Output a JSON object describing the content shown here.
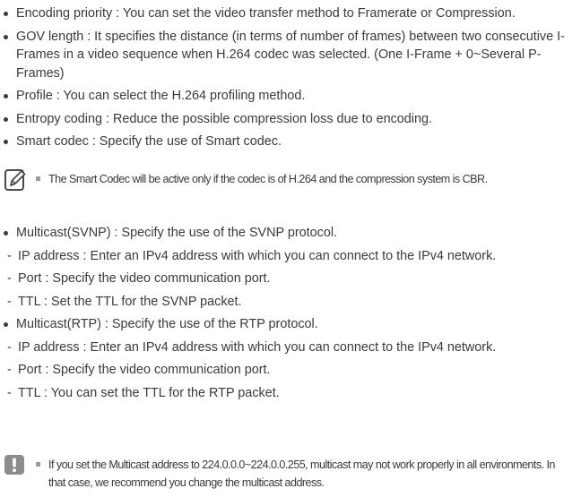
{
  "section1": {
    "items": [
      "Encoding priority : You can set the video transfer method to Framerate or Compression.",
      "GOV length : It specifies the distance (in terms of number of frames) between two consecutive I-Frames in a video sequence when H.264 codec was selected. (One I-Frame + 0~Several P-Frames)",
      "Profile : You can select the H.264 profiling method.",
      "Entropy coding : Reduce the possible compression loss due to encoding.",
      "Smart codec : Specify the use of Smart codec."
    ]
  },
  "note1": {
    "icon": "pencil-note-icon",
    "text": "The Smart Codec will be active only if the codec is of H.264 and the compression system is CBR."
  },
  "section2": {
    "svnp": {
      "title": "Multicast(SVNP) : Specify the use of the SVNP protocol.",
      "subs": [
        "IP address : Enter an IPv4 address with which you can connect to the IPv4 network.",
        "Port : Specify the video communication port.",
        "TTL : Set the TTL for the SVNP packet."
      ]
    },
    "rtp": {
      "title": "Multicast(RTP) : Specify the use of the RTP protocol.",
      "subs": [
        "IP address : Enter an IPv4 address with which you can connect to the IPv4 network.",
        "Port : Specify the video communication port.",
        "TTL : You can set the TTL for the RTP packet."
      ]
    }
  },
  "note2": {
    "icon": "warning-icon",
    "text": "If you set the Multicast address to 224.0.0.0~224.0.0.255, multicast may not work properly in all environments. In that case, we recommend you change the multicast address."
  }
}
